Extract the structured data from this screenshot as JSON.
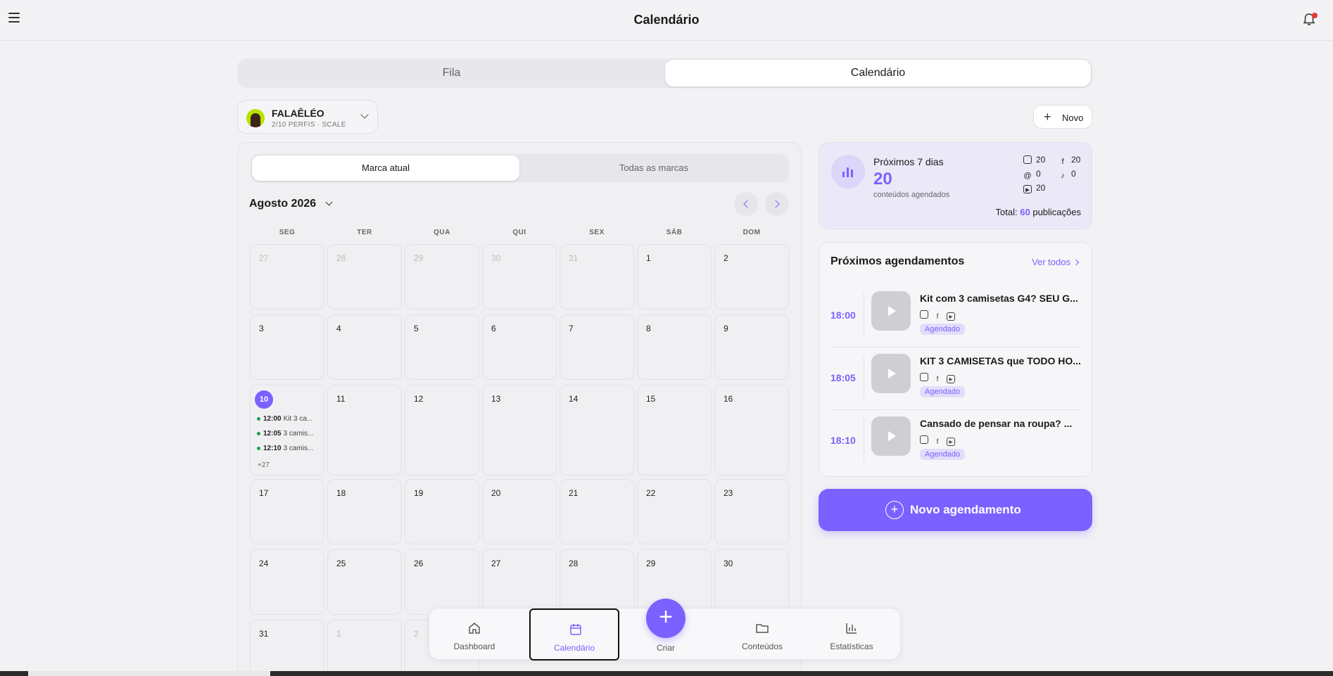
{
  "header": {
    "title": "Calendário"
  },
  "view_tabs": [
    "Fila",
    "Calendário"
  ],
  "profile": {
    "name": "FALAÊLÉO",
    "sub": "2/10 PERFIS · SCALE"
  },
  "new_button": "Novo",
  "calendar": {
    "scope_tabs": [
      "Marca atual",
      "Todas as marcas"
    ],
    "month": "Agosto 2026",
    "weekdays": [
      "SEG",
      "TER",
      "QUA",
      "QUI",
      "SEX",
      "SÁB",
      "DOM"
    ],
    "weeks": [
      [
        "27",
        "28",
        "29",
        "30",
        "31",
        "1",
        "2"
      ],
      [
        "3",
        "4",
        "5",
        "6",
        "7",
        "8",
        "9"
      ],
      [
        "10",
        "11",
        "12",
        "13",
        "14",
        "15",
        "16"
      ],
      [
        "17",
        "18",
        "19",
        "20",
        "21",
        "22",
        "23"
      ],
      [
        "24",
        "25",
        "26",
        "27",
        "28",
        "29",
        "30"
      ],
      [
        "31",
        "1",
        "2",
        "",
        "",
        "",
        ""
      ]
    ],
    "today": "10",
    "today_events": [
      {
        "time": "12:00",
        "title": "Kit 3 ca..."
      },
      {
        "time": "12:05",
        "title": "3 camis..."
      },
      {
        "time": "12:10",
        "title": "3 camis..."
      }
    ],
    "today_more": "+27"
  },
  "stats": {
    "title": "Próximos 7 dias",
    "count": "20",
    "subtitle": "conteúdos agendados",
    "platforms": [
      {
        "icon": "instagram-icon",
        "value": "20"
      },
      {
        "icon": "facebook-icon",
        "value": "20"
      },
      {
        "icon": "threads-icon",
        "value": "0"
      },
      {
        "icon": "tiktok-icon",
        "value": "0"
      },
      {
        "icon": "youtube-icon",
        "value": "20"
      }
    ],
    "total_label": "Total:",
    "total_value": "60",
    "total_suffix": "publicações"
  },
  "upcoming": {
    "title": "Próximos agendamentos",
    "see_all": "Ver todos",
    "items": [
      {
        "time": "18:00",
        "title": "Kit com 3 camisetas G4? SEU G...",
        "status": "Agendado"
      },
      {
        "time": "18:05",
        "title": "KIT 3 CAMISETAS que TODO HO...",
        "status": "Agendado"
      },
      {
        "time": "18:10",
        "title": "Cansado de pensar na roupa? ...",
        "status": "Agendado"
      }
    ]
  },
  "new_schedule_button": "Novo agendamento",
  "bottom_nav": {
    "items": [
      "Dashboard",
      "Calendário",
      "Conteúdos",
      "Estatísticas"
    ],
    "create": "Criar",
    "active": "Calendário"
  },
  "colors": {
    "accent": "#7b61ff",
    "success": "#16a34a",
    "background": "#f2f2f5"
  }
}
